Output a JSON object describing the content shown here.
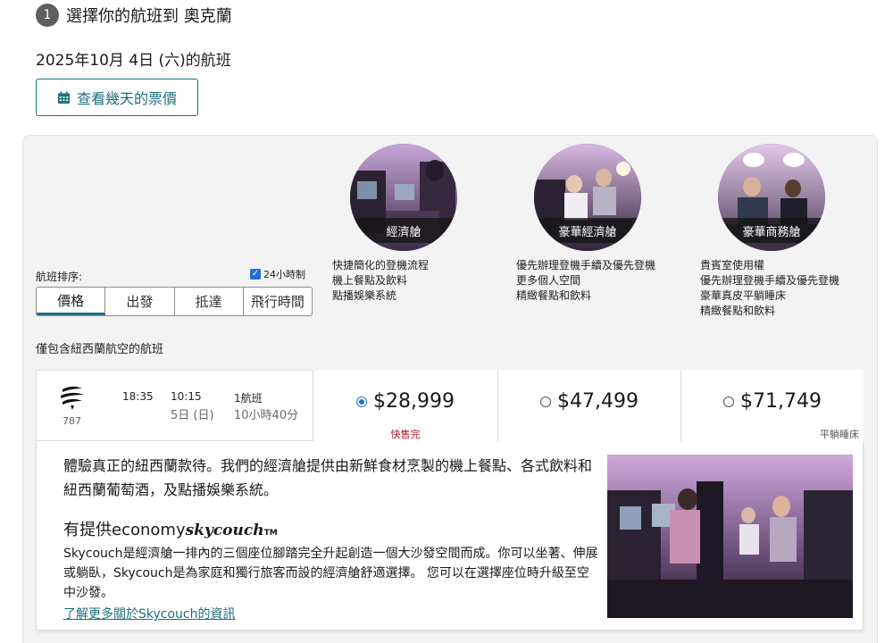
{
  "step": {
    "number": "1",
    "title": "選擇你的航班到 奧克蘭"
  },
  "date_heading": "2025年10月 4日 (六)的航班",
  "price_days_button": {
    "label": "查看幾天的票價",
    "icon": "calendar-icon"
  },
  "cabins": [
    {
      "name": "經濟艙",
      "features": [
        "快捷簡化的登機流程",
        "機上餐點及飲料",
        "點播娛樂系統"
      ]
    },
    {
      "name": "豪華經濟艙",
      "features": [
        "優先辦理登機手續及優先登機",
        "更多個人空間",
        "精緻餐點和飲料"
      ]
    },
    {
      "name": "豪華商務艙",
      "features": [
        "貴賓室使用權",
        "優先辦理登機手續及優先登機",
        "豪華真皮平躺睡床",
        "精緻餐點和飲料"
      ]
    }
  ],
  "sort": {
    "label": "航班排序:",
    "checkbox_label": "24小時制",
    "checkbox_checked": true,
    "tabs": [
      "價格",
      "出發",
      "抵達",
      "飛行時間"
    ],
    "active_tab": "價格"
  },
  "filter_note": "僅包含紐西蘭航空的航班",
  "flight": {
    "aircraft": "787",
    "departure": "18:35",
    "arrival": "10:15",
    "arrival_day": "5日 (日)",
    "stops": "1航班",
    "duration": "10小時40分",
    "fares": [
      {
        "price": "$28,999",
        "selected": true,
        "note": "快售完"
      },
      {
        "price": "$47,499",
        "selected": false,
        "note": ""
      },
      {
        "price": "$71,749",
        "selected": false,
        "note": "平躺睡床"
      }
    ]
  },
  "detail": {
    "intro": "體驗真正的紐西蘭款待。我們的經濟艙提供由新鮮食材烹製的機上餐點、各式飲料和紐西蘭葡萄酒，及點播娛樂系統。",
    "skycouch_prefix": "有提供economy",
    "skycouch_brand": "skycouch",
    "skycouch_tm": "TM",
    "skycouch_desc": "Skycouch是經濟艙一排內的三個座位腳踏完全升起創造一個大沙發空間而成。你可以坐著、伸展或躺臥，Skycouch是為家庭和獨行旅客而設的經濟艙舒適選擇。 您可以在選擇座位時升級至空中沙發。",
    "link": "了解更多關於Skycouch的資訊"
  },
  "colors": {
    "teal": "#1e7281",
    "selected_radio": "#1f6fd1",
    "sell_out_red": "#b3121f",
    "panel_bg": "#f3f3f3"
  }
}
